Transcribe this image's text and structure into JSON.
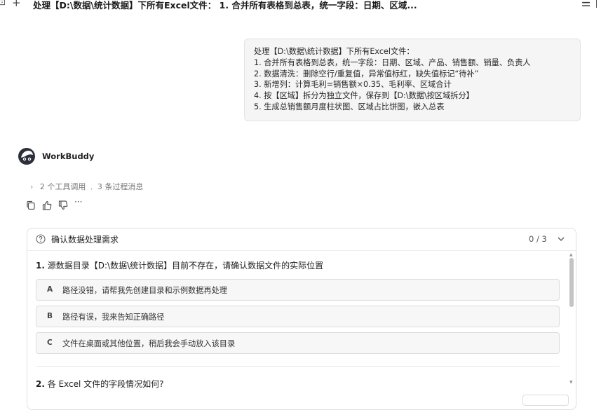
{
  "topbar": {
    "edge_glyph": "⊡",
    "new_tab": "+",
    "title": "处理【D:\\数据\\统计数据】下所有Excel文件： 1. 合并所有表格到总表，统一字段：日期、区域...",
    "menu_glyph": "☰"
  },
  "user_message": {
    "lines": [
      "处理【D:\\数据\\统计数据】下所有Excel文件：",
      "1. 合并所有表格到总表，统一字段：日期、区域、产品、销售额、销量、负责人",
      "2. 数据清洗：删除空行/重复值，异常值标红，缺失值标记“待补”",
      "3. 新增列：计算毛利=销售额×0.35、毛利率、区域合计",
      "4. 按【区域】拆分为独立文件，保存到【D:\\数据\\按区域拆分】",
      "5. 生成总销售额月度柱状图、区域占比饼图，嵌入总表"
    ]
  },
  "assistant": {
    "name": "WorkBuddy",
    "tool_calls_count": "2",
    "tool_calls_label": "个工具调用",
    "separator": ",",
    "process_count": "3",
    "process_label": "条过程消息"
  },
  "card": {
    "title": "确认数据处理需求",
    "progress": "0 / 3",
    "question1": {
      "number": "1.",
      "text": "源数据目录【D:\\数据\\统计数据】目前不存在，请确认数据文件的实际位置",
      "options": [
        {
          "letter": "A",
          "text": "路径没错，请帮我先创建目录和示例数据再处理"
        },
        {
          "letter": "B",
          "text": "路径有误，我来告知正确路径"
        },
        {
          "letter": "C",
          "text": "文件在桌面或其他位置，稍后我会手动放入该目录"
        }
      ]
    },
    "question2": {
      "number": "2.",
      "text": "各 Excel 文件的字段情况如何?"
    }
  },
  "icons": {
    "ellipsis": "···"
  }
}
